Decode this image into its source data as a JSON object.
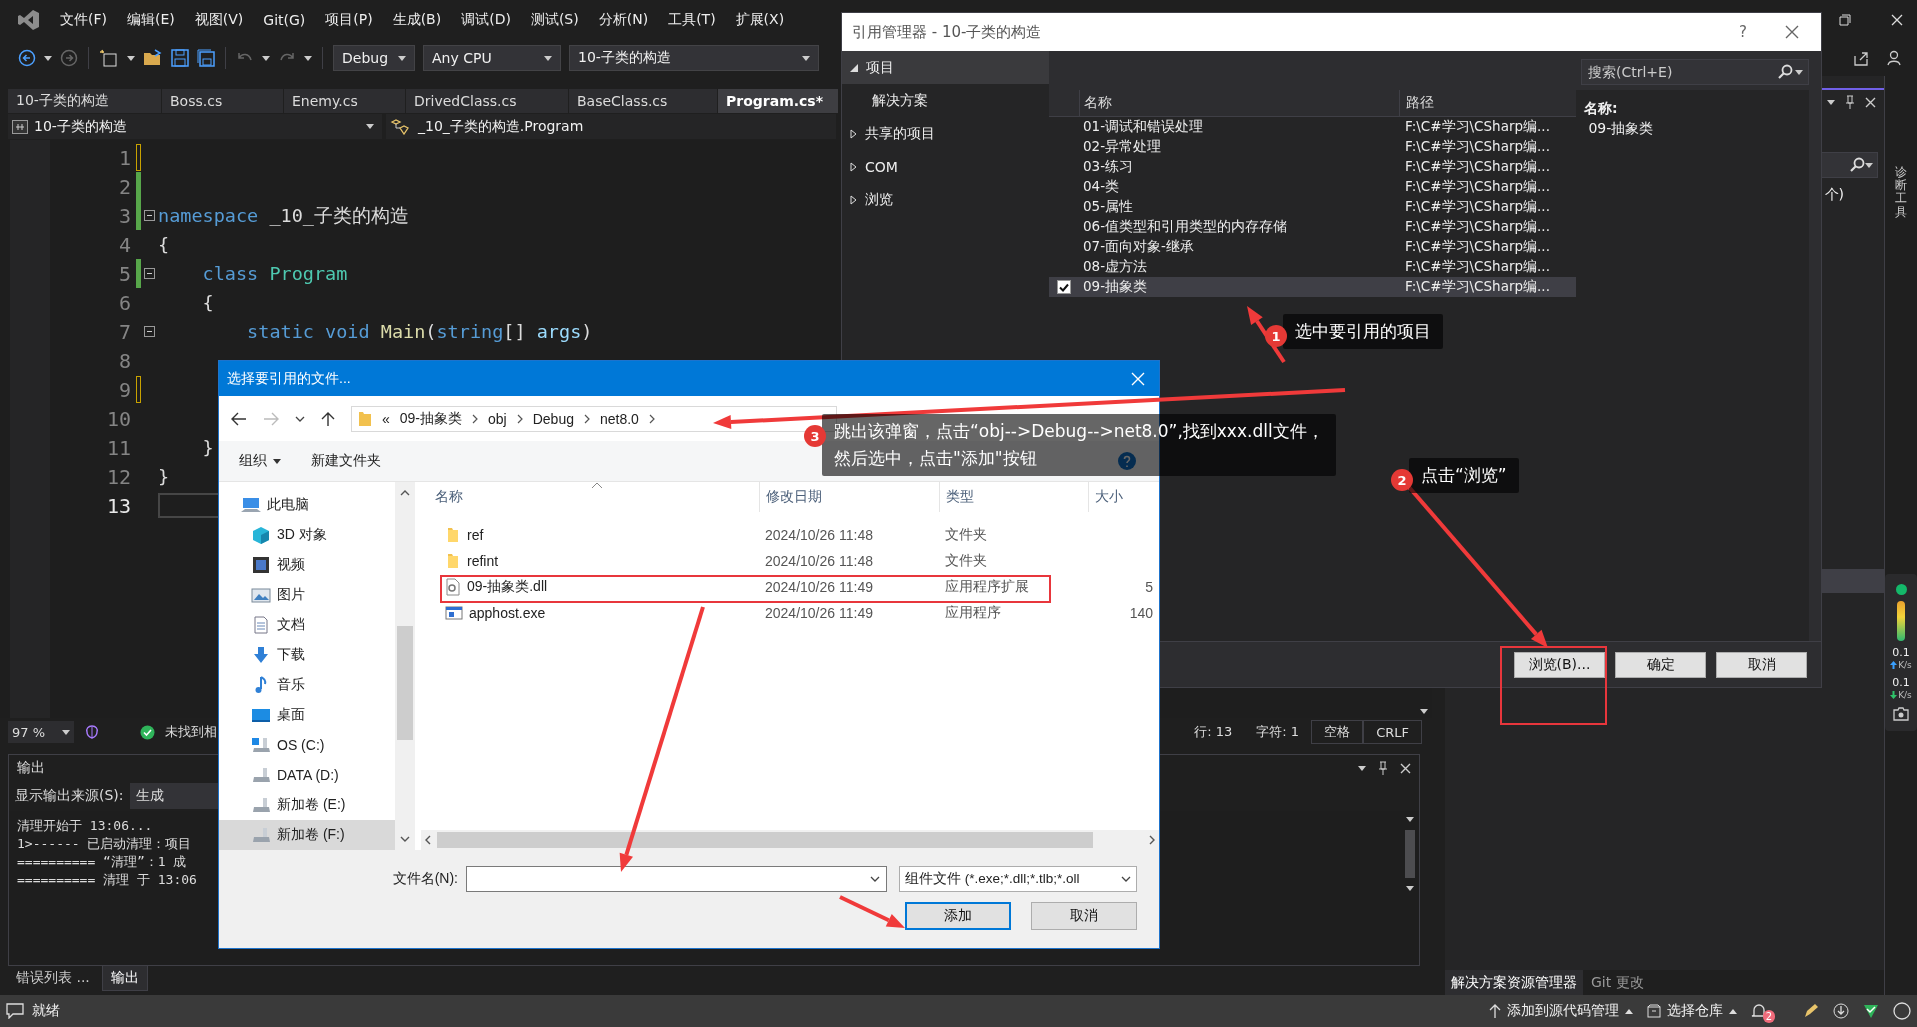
{
  "menu": [
    "文件(F)",
    "编辑(E)",
    "视图(V)",
    "Git(G)",
    "项目(P)",
    "生成(B)",
    "调试(D)",
    "测试(S)",
    "分析(N)",
    "工具(T)",
    "扩展(X)"
  ],
  "toolbar": {
    "configuration": "Debug",
    "platform": "Any CPU",
    "startup_project": "10-子类的构造"
  },
  "doc_tabs": [
    {
      "label": "10-子类的构造",
      "selected": false
    },
    {
      "label": "Boss.cs",
      "selected": false
    },
    {
      "label": "Enemy.cs",
      "selected": false
    },
    {
      "label": "DrivedClass.cs",
      "selected": false
    },
    {
      "label": "BaseClass.cs",
      "selected": false
    },
    {
      "label": "Program.cs*",
      "selected": true
    }
  ],
  "nav_bar": {
    "project": "10-子类的构造",
    "member": "_10_子类的构造.Program"
  },
  "code": [
    {
      "number": "1",
      "current": false,
      "change_bar": true,
      "saved": false,
      "fold": false
    },
    {
      "number": "2",
      "current": false,
      "change_bar": true,
      "saved": true,
      "fold": false
    },
    {
      "number": "3",
      "current": false,
      "change_bar": true,
      "saved": true,
      "fold": true,
      "tokens": [
        {
          "text": "namespace",
          "kind": "keyword"
        },
        {
          "text": " _10_子类的构造",
          "kind": "plain"
        }
      ]
    },
    {
      "number": "4",
      "current": false,
      "change_bar": false,
      "fold": false,
      "tokens": [
        {
          "text": "{",
          "kind": "plain"
        }
      ]
    },
    {
      "number": "5",
      "current": false,
      "change_bar": true,
      "saved": true,
      "fold": true,
      "tokens": [
        {
          "text": "    class",
          "kind": "keyword"
        },
        {
          "text": " Program",
          "kind": "type"
        }
      ]
    },
    {
      "number": "6",
      "current": false,
      "change_bar": false,
      "fold": false,
      "tokens": [
        {
          "text": "    {",
          "kind": "plain"
        }
      ]
    },
    {
      "number": "7",
      "current": false,
      "change_bar": false,
      "fold": true,
      "tokens": [
        {
          "text": "        static void",
          "kind": "keyword"
        },
        {
          "text": " Main",
          "kind": "method"
        },
        {
          "text": "(",
          "kind": "plain"
        },
        {
          "text": "string",
          "kind": "keyword"
        },
        {
          "text": "[]",
          "kind": "plain"
        },
        {
          "text": " args",
          "kind": "param"
        },
        {
          "text": ")",
          "kind": "plain"
        }
      ]
    },
    {
      "number": "8",
      "current": false,
      "change_bar": false,
      "fold": false
    },
    {
      "number": "9",
      "current": false,
      "change_bar": true,
      "saved": false,
      "fold": false
    },
    {
      "number": "10",
      "current": false,
      "change_bar": false,
      "fold": false
    },
    {
      "number": "11",
      "current": false,
      "change_bar": false,
      "fold": false,
      "tokens": [
        {
          "text": "    }",
          "kind": "plain"
        }
      ]
    },
    {
      "number": "12",
      "current": false,
      "change_bar": false,
      "fold": false,
      "tokens": [
        {
          "text": "}",
          "kind": "plain"
        }
      ]
    },
    {
      "number": "13",
      "current": true,
      "change_bar": false,
      "fold": false
    }
  ],
  "editor_status": {
    "zoom": "97 %",
    "message": "未找到相",
    "line": "行: 13",
    "column": "字符: 1",
    "indent": "空格",
    "line_ending": "CRLF"
  },
  "output": {
    "title": "输出",
    "source_label": "显示输出来源(S):",
    "source": "生成",
    "lines": [
      "清理开始于 13:06...",
      "1>------ 已启动清理：项目",
      "========== “清理”：1 成",
      "========== 清理 于 13:06"
    ]
  },
  "bottom_tabs": [
    {
      "label": "错误列表 ...",
      "selected": false
    },
    {
      "label": "输出",
      "selected": true
    }
  ],
  "side_panel": {
    "fragment": "个)",
    "diagnostics_tab": "诊断工具",
    "tabs": [
      {
        "label": "解决方案资源管理器",
        "selected": true
      },
      {
        "label": "Git 更改",
        "selected": false
      }
    ],
    "network": [
      {
        "value": "0.1",
        "unit": "K/s",
        "kind": "upload"
      },
      {
        "value": "0.1",
        "unit": "K/s",
        "kind": "download"
      }
    ]
  },
  "status_bar": {
    "message": "就绪",
    "source_control": "添加到源代码管理",
    "repository": "选择仓库",
    "notifications": "2"
  },
  "reference_manager": {
    "title": "引用管理器 - 10-子类的构造",
    "help": "?",
    "nav": [
      {
        "label": "项目",
        "expanded": true,
        "selected": true,
        "children": [
          {
            "label": "解决方案",
            "selected": false
          }
        ]
      },
      {
        "label": "共享的项目",
        "expanded": false,
        "selected": false
      },
      {
        "label": "COM",
        "expanded": false,
        "selected": false
      },
      {
        "label": "浏览",
        "expanded": false,
        "selected": false
      }
    ],
    "search": {
      "placeholder": "搜索(Ctrl+E)"
    },
    "columns": [
      "名称",
      "路径"
    ],
    "rows": [
      {
        "name": "01-调试和错误处理",
        "path": "F:\\C#学习\\CSharp编...",
        "checked": false,
        "selected": false
      },
      {
        "name": "02-异常处理",
        "path": "F:\\C#学习\\CSharp编...",
        "checked": false,
        "selected": false
      },
      {
        "name": "03-练习",
        "path": "F:\\C#学习\\CSharp编...",
        "checked": false,
        "selected": false
      },
      {
        "name": "04-类",
        "path": "F:\\C#学习\\CSharp编...",
        "checked": false,
        "selected": false
      },
      {
        "name": "05-属性",
        "path": "F:\\C#学习\\CSharp编...",
        "checked": false,
        "selected": false
      },
      {
        "name": "06-值类型和引用类型的内存存储",
        "path": "F:\\C#学习\\CSharp编...",
        "checked": false,
        "selected": false
      },
      {
        "name": "07-面向对象-继承",
        "path": "F:\\C#学习\\CSharp编...",
        "checked": false,
        "selected": false
      },
      {
        "name": "08-虚方法",
        "path": "F:\\C#学习\\CSharp编...",
        "checked": false,
        "selected": false
      },
      {
        "name": "09-抽象类",
        "path": "F:\\C#学习\\CSharp编...",
        "checked": true,
        "selected": true
      }
    ],
    "details": {
      "label": "名称:",
      "value": "09-抽象类"
    },
    "buttons": [
      "浏览(B)...",
      "确定",
      "取消"
    ]
  },
  "file_dialog": {
    "title": "选择要引用的文件...",
    "path_prefix": "«",
    "path": [
      "09-抽象类",
      "obj",
      "Debug",
      "net8.0"
    ],
    "toolbar": [
      "组织",
      "新建文件夹"
    ],
    "nav": [
      {
        "label": "此电脑",
        "kind": "computer",
        "selected": false
      },
      {
        "label": "3D 对象",
        "kind": "objects",
        "selected": false
      },
      {
        "label": "视频",
        "kind": "videos",
        "selected": false
      },
      {
        "label": "图片",
        "kind": "pictures",
        "selected": false
      },
      {
        "label": "文档",
        "kind": "documents",
        "selected": false
      },
      {
        "label": "下载",
        "kind": "downloads",
        "selected": false
      },
      {
        "label": "音乐",
        "kind": "music",
        "selected": false
      },
      {
        "label": "桌面",
        "kind": "desktop",
        "selected": false
      },
      {
        "label": "OS (C:)",
        "kind": "system_drive",
        "selected": false
      },
      {
        "label": "DATA (D:)",
        "kind": "drive",
        "selected": false
      },
      {
        "label": "新加卷 (E:)",
        "kind": "drive",
        "selected": false
      },
      {
        "label": "新加卷 (F:)",
        "kind": "drive",
        "selected": true
      }
    ],
    "columns": [
      "名称",
      "修改日期",
      "类型",
      "大小"
    ],
    "files": [
      {
        "name": "ref",
        "kind": "folder",
        "modified": "2024/10/26 11:48",
        "type": "文件夹"
      },
      {
        "name": "refint",
        "kind": "folder",
        "modified": "2024/10/26 11:48",
        "type": "文件夹"
      },
      {
        "name": "09-抽象类.dll",
        "kind": "library",
        "modified": "2024/10/26 11:49",
        "type": "应用程序扩展",
        "size": "5"
      },
      {
        "name": "apphost.exe",
        "kind": "program",
        "modified": "2024/10/26 11:49",
        "type": "应用程序",
        "size": "140"
      }
    ],
    "file_name_label": "文件名(N):",
    "filter": "组件文件 (*.exe;*.dll;*.tlb;*.oll",
    "buttons": [
      "添加",
      "取消"
    ]
  },
  "annotations": [
    {
      "number": "1",
      "lines": [
        "选中要引用的项目"
      ]
    },
    {
      "number": "2",
      "lines": [
        "点击“浏览”"
      ]
    },
    {
      "number": "3",
      "lines": [
        "跳出该弹窗，点击“obj-->Debug-->net8.0”,找到xxx.dll文件，",
        "然后选中，点击\"添加\"按钮"
      ]
    }
  ]
}
